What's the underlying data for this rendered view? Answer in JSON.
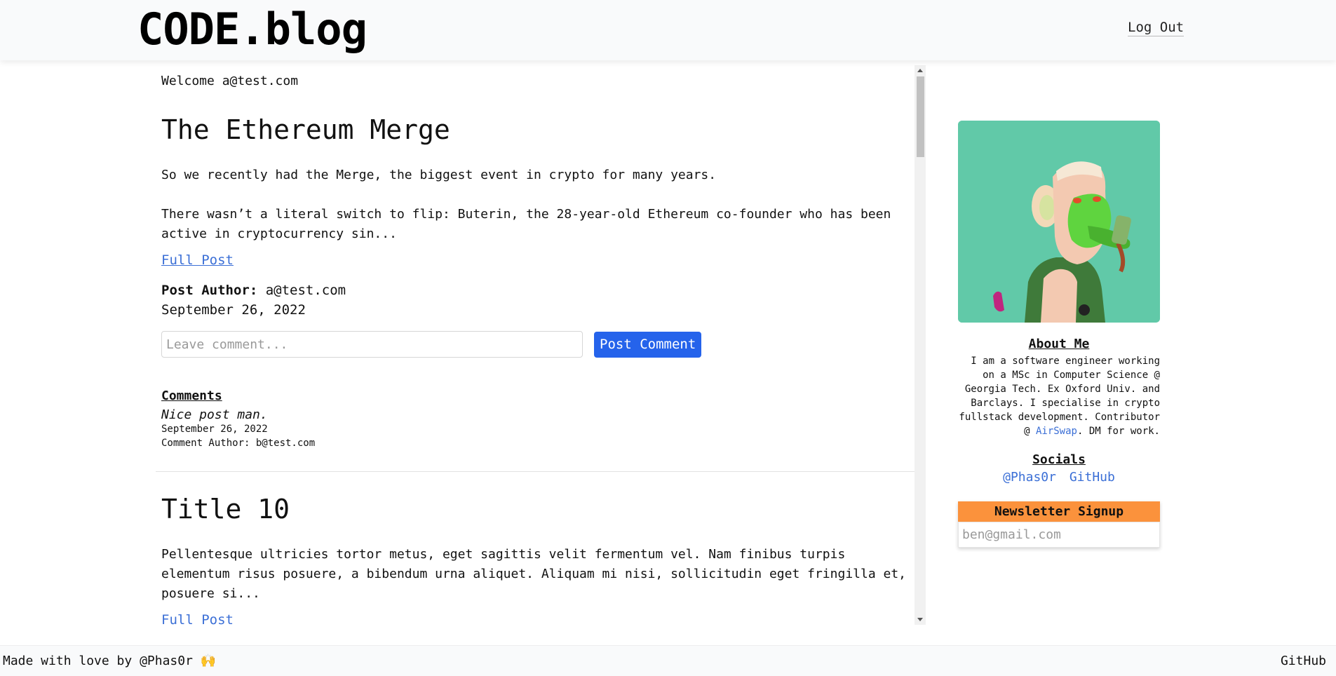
{
  "header": {
    "logo": "CODE.blog",
    "logout_label": "Log Out"
  },
  "feed": {
    "welcome": "Welcome a@test.com",
    "posts": [
      {
        "title": "The Ethereum Merge",
        "body": "So we recently had the Merge, the biggest event in crypto for many years.\n\nThere wasn’t a literal switch to flip: Buterin, the 28-year-old Ethereum co-founder who has been active in cryptocurrency sin...",
        "full_post_label": "Full Post",
        "author_label": "Post Author:",
        "author": "a@test.com",
        "date": "September 26, 2022",
        "comment_placeholder": "Leave comment...",
        "comment_button": "Post Comment",
        "comments_heading": "Comments",
        "comments": [
          {
            "text": "Nice post man.",
            "date": "September 26, 2022",
            "author": "Comment Author: b@test.com"
          }
        ]
      },
      {
        "title": "Title 10",
        "body": "Pellentesque ultricies tortor metus, eget sagittis velit fermentum vel. Nam finibus turpis elementum risus posuere, a bibendum urna aliquet. Aliquam mi nisi, sollicitudin eget fringilla et, posuere si...",
        "full_post_label": "Full Post"
      }
    ]
  },
  "sidebar": {
    "about_heading": "About Me",
    "about_text_1": "I am a software engineer working on a MSc in Computer Science @ Georgia Tech. Ex Oxford Univ. and Barclays. I specialise in crypto fullstack development. Contributor @ ",
    "about_link": "AirSwap",
    "about_text_2": ". DM for work.",
    "socials_heading": "Socials",
    "social_twitter": "@Phas0r",
    "social_github": "GitHub",
    "newsletter_heading": "Newsletter Signup",
    "newsletter_placeholder": "ben@gmail.com"
  },
  "footer": {
    "left": "Made with love by @Phas0r 🙌",
    "right": "GitHub"
  },
  "colors": {
    "accent_blue": "#2563eb",
    "link_blue": "#3b6fd6",
    "newsletter_orange": "#fb923c",
    "avatar_bg": "#61c9a8"
  }
}
